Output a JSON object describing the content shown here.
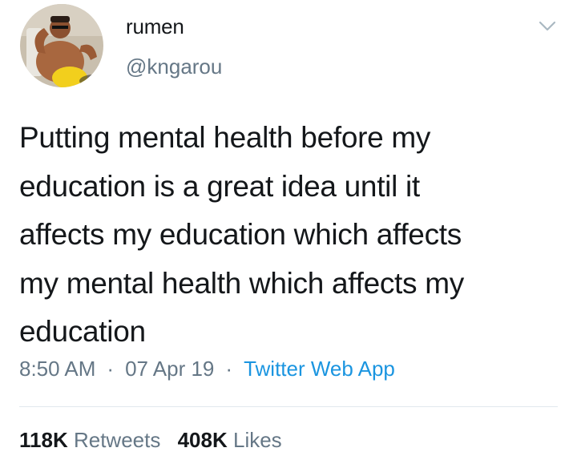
{
  "user": {
    "display_name": "rumen",
    "handle": "@kngarou"
  },
  "tweet": {
    "text_lines": [
      "Putting mental health before my",
      "education is a great idea until it",
      "affects my education which affects",
      "my mental health which affects my",
      "education"
    ],
    "time": "8:50 AM",
    "date": "07 Apr 19",
    "source": "Twitter Web App",
    "separator": "·"
  },
  "stats": {
    "retweets_count": "118K",
    "retweets_label": "Retweets",
    "likes_count": "408K",
    "likes_label": "Likes"
  },
  "icons": {
    "menu": "chevron-down-icon"
  },
  "colors": {
    "text": "#14171a",
    "secondary": "#657786",
    "link": "#1b95e0",
    "divider": "#e1e8ed"
  }
}
